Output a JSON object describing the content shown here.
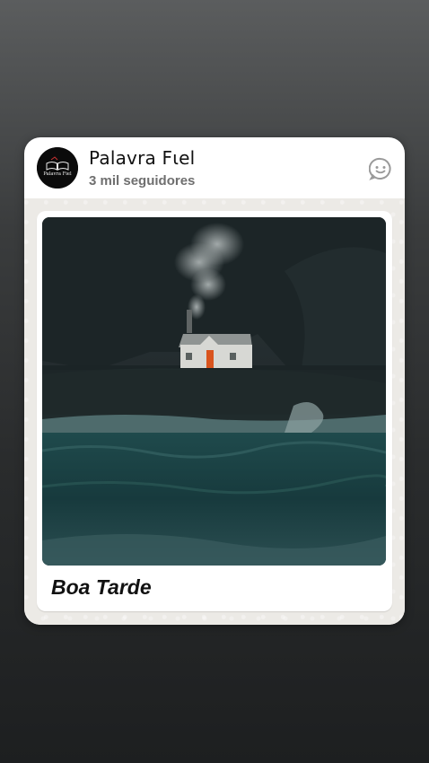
{
  "channel": {
    "name": "Palavra Fιel",
    "followers": "3 mil seguidores",
    "avatar_text": "Palavra Fiel"
  },
  "message": {
    "image_description_icon": "house-on-cliff-photo",
    "caption": "Boa Tarde"
  },
  "icons": {
    "react": "emoji-react-icon"
  },
  "colors": {
    "card_bg": "#ffffff",
    "chat_bg": "#eceae6",
    "secondary_text": "#6f6f6f"
  }
}
